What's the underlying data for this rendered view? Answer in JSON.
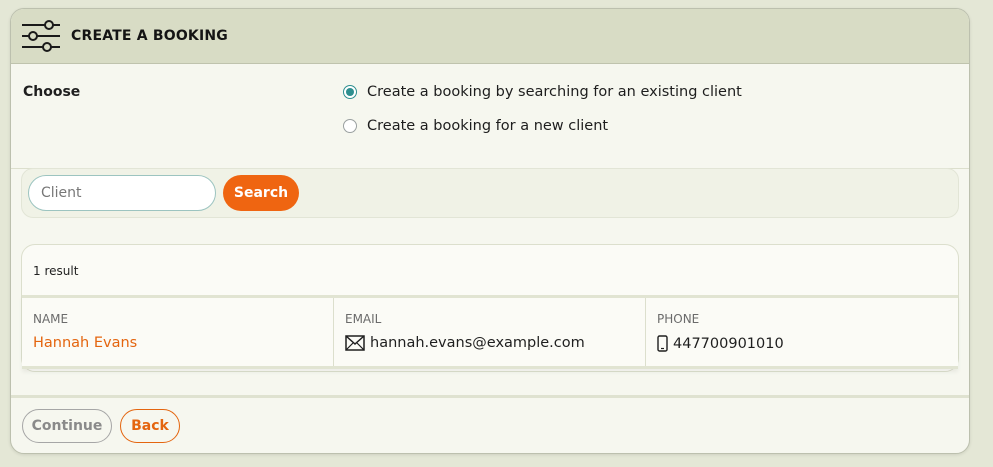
{
  "header": {
    "title": "CREATE A BOOKING",
    "icon": "sliders-icon"
  },
  "choose": {
    "label": "Choose",
    "options": [
      {
        "label": "Create a booking by searching for an existing client",
        "checked": true
      },
      {
        "label": "Create a booking for a new client",
        "checked": false
      }
    ]
  },
  "search": {
    "placeholder": "Client",
    "value": "",
    "button_label": "Search"
  },
  "results": {
    "count_text": "1 result",
    "columns": [
      "NAME",
      "EMAIL",
      "PHONE"
    ],
    "rows": [
      {
        "name": "Hannah Evans",
        "email": "hannah.evans@example.com",
        "phone": "447700901010",
        "email_icon": "envelope-icon",
        "phone_icon": "mobile-phone-icon"
      }
    ]
  },
  "footer": {
    "continue_label": "Continue",
    "back_label": "Back"
  },
  "colors": {
    "accent": "#ef6511",
    "radio_checked": "#2e8f8f",
    "header_bg": "#d8dcc5",
    "page_bg": "#e4e7d6"
  }
}
